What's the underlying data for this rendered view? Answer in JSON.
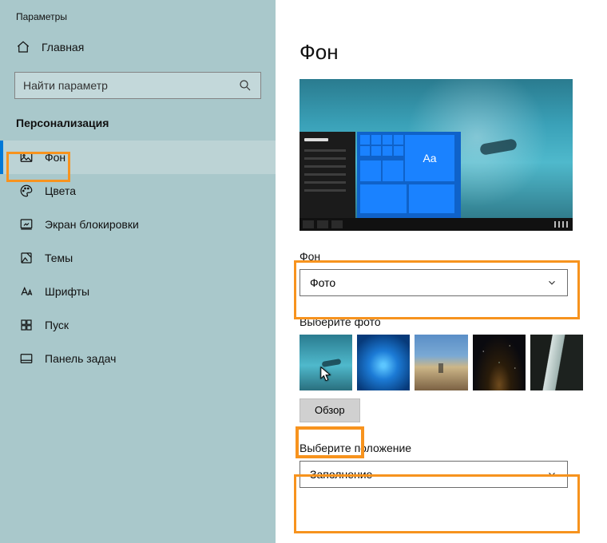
{
  "window": {
    "title": "Параметры"
  },
  "sidebar": {
    "home": "Главная",
    "search_placeholder": "Найти параметр",
    "category": "Персонализация",
    "items": [
      {
        "icon": "image-icon",
        "label": "Фон",
        "active": true
      },
      {
        "icon": "palette-icon",
        "label": "Цвета"
      },
      {
        "icon": "lockscreen-icon",
        "label": "Экран блокировки"
      },
      {
        "icon": "themes-icon",
        "label": "Темы"
      },
      {
        "icon": "fonts-icon",
        "label": "Шрифты"
      },
      {
        "icon": "start-icon",
        "label": "Пуск"
      },
      {
        "icon": "taskbar-icon",
        "label": "Панель задач"
      }
    ]
  },
  "main": {
    "title": "Фон",
    "preview_tile_text": "Aa",
    "background_label": "Фон",
    "background_value": "Фото",
    "choose_photo_label": "Выберите фото",
    "browse_label": "Обзор",
    "fit_label": "Выберите положение",
    "fit_value": "Заполнение"
  },
  "colors": {
    "highlight": "#f7931e",
    "accent": "#0078d7"
  }
}
